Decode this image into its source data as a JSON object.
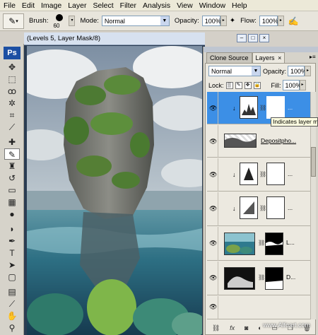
{
  "menu": [
    "File",
    "Edit",
    "Image",
    "Layer",
    "Select",
    "Filter",
    "Analysis",
    "View",
    "Window",
    "Help"
  ],
  "options": {
    "brush_label": "Brush:",
    "brush_size": "60",
    "mode_label": "Mode:",
    "mode_value": "Normal",
    "opacity_label": "Opacity:",
    "opacity_value": "100%",
    "flow_label": "Flow:",
    "flow_value": "100%"
  },
  "toolbox": {
    "logo": "Ps"
  },
  "document": {
    "title": "(Levels 5, Layer Mask/8)"
  },
  "panel": {
    "tabs": [
      "Clone Source",
      "Layers"
    ],
    "tab_close": "×",
    "blend_mode": "Normal",
    "opacity_label": "Opacity:",
    "opacity_value": "100%",
    "lock_label": "Lock:",
    "fill_label": "Fill:",
    "fill_value": "100%",
    "layers": [
      {
        "name": "...",
        "selected": true
      },
      {
        "name": "Depositpho...",
        "selected": false
      },
      {
        "name": "...",
        "selected": false
      },
      {
        "name": "...",
        "selected": false
      },
      {
        "name": "L...",
        "selected": false
      },
      {
        "name": "D...",
        "selected": false
      }
    ],
    "tooltip": "Indicates layer mask",
    "bottom_icons": [
      "link-icon",
      "fx-icon",
      "mask-icon",
      "adjustment-icon",
      "folder-icon",
      "new-layer-icon",
      "trash-icon"
    ]
  },
  "watermark": "www.Alfoart.com",
  "colors": {
    "selected_layer": "#3c8fe6",
    "panel_bg": "#ece9e0",
    "ps_logo": "#1c4fa3"
  }
}
